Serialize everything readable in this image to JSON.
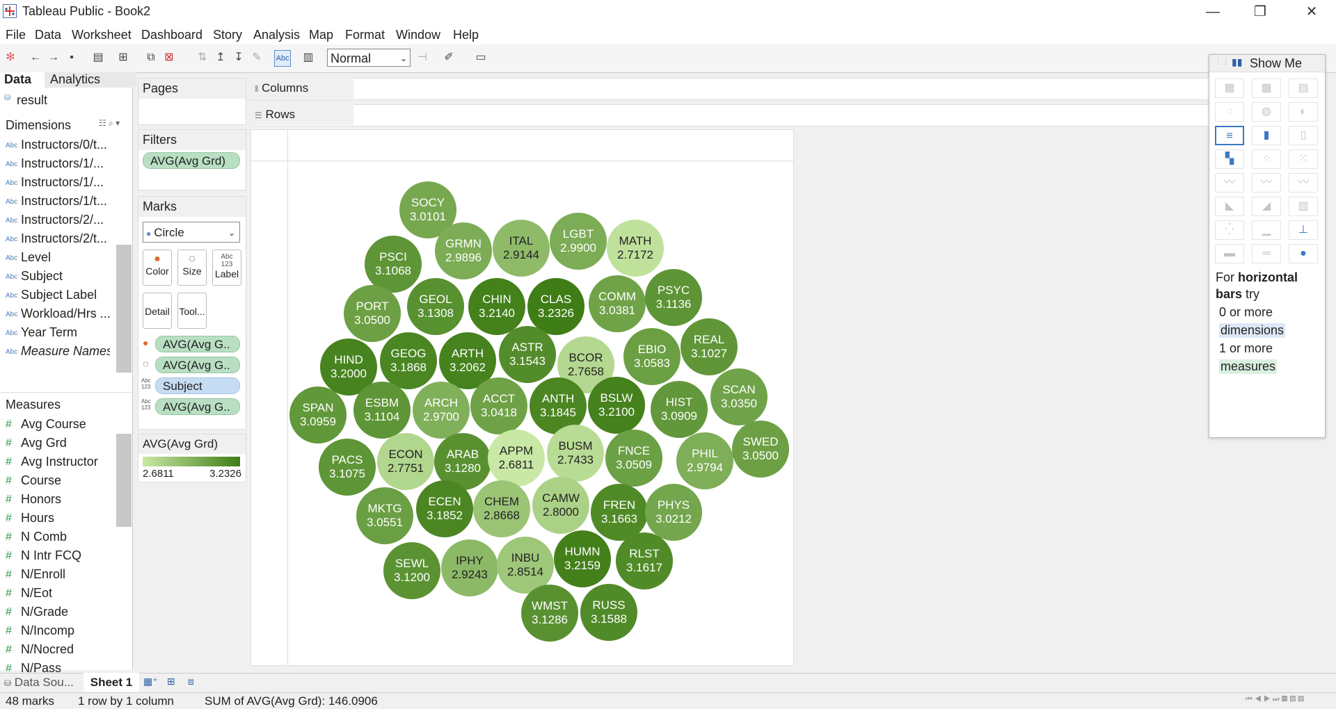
{
  "window": {
    "title": "Tableau Public - Book2",
    "min": "—",
    "restore": "❐",
    "close": "✕"
  },
  "menu": [
    "File",
    "Data",
    "Worksheet",
    "Dashboard",
    "Story",
    "Analysis",
    "Map",
    "Format",
    "Window",
    "Help"
  ],
  "toolbar": {
    "fit_value": "Normal"
  },
  "left": {
    "tabs": [
      "Data",
      "Analytics"
    ],
    "datasource": "result",
    "dimensions_header": "Dimensions",
    "dimensions": [
      "Instructors/0/t...",
      "Instructors/1/...",
      "Instructors/1/...",
      "Instructors/1/t...",
      "Instructors/2/...",
      "Instructors/2/t...",
      "Level",
      "Subject",
      "Subject Label",
      "Workload/Hrs ...",
      "Year Term",
      "Measure Names"
    ],
    "measures_header": "Measures",
    "measures": [
      "Avg Course",
      "Avg Grd",
      "Avg Instructor",
      "Course",
      "Honors",
      "Hours",
      "N Comb",
      "N Intr FCQ",
      "N/Enroll",
      "N/Eot",
      "N/Grade",
      "N/Incomp",
      "N/Nocred",
      "N/Pass"
    ]
  },
  "pages": {
    "title": "Pages"
  },
  "filters": {
    "title": "Filters",
    "pill": "AVG(Avg Grd)"
  },
  "marks": {
    "title": "Marks",
    "type": "Circle",
    "buttons": [
      "Color",
      "Size",
      "Label",
      "Detail",
      "Tool..."
    ],
    "pills": [
      "AVG(Avg G..",
      "AVG(Avg G..",
      "Subject",
      "AVG(Avg G.."
    ]
  },
  "legend": {
    "title": "AVG(Avg Grd)",
    "min": "2.6811",
    "max": "3.2326",
    "color_low": "#c9e8a5",
    "color_high": "#3f7d16"
  },
  "shelves": {
    "columns": "Columns",
    "rows": "Rows"
  },
  "chart_data": {
    "type": "packed-bubble",
    "measure": "AVG(Avg Grd)",
    "items": [
      {
        "subject": "SOCY",
        "value": 3.0101
      },
      {
        "subject": "PSCI",
        "value": 3.1068
      },
      {
        "subject": "GRMN",
        "value": 2.9896
      },
      {
        "subject": "ITAL",
        "value": 2.9144
      },
      {
        "subject": "LGBT",
        "value": 2.99
      },
      {
        "subject": "MATH",
        "value": 2.7172
      },
      {
        "subject": "PORT",
        "value": 3.05
      },
      {
        "subject": "GEOL",
        "value": 3.1308
      },
      {
        "subject": "CHIN",
        "value": 3.214
      },
      {
        "subject": "CLAS",
        "value": 3.2326
      },
      {
        "subject": "COMM",
        "value": 3.0381
      },
      {
        "subject": "PSYC",
        "value": 3.1136
      },
      {
        "subject": "HIND",
        "value": 3.2
      },
      {
        "subject": "GEOG",
        "value": 3.1868
      },
      {
        "subject": "ARTH",
        "value": 3.2062
      },
      {
        "subject": "ASTR",
        "value": 3.1543
      },
      {
        "subject": "BCOR",
        "value": 2.7658
      },
      {
        "subject": "EBIO",
        "value": 3.0583
      },
      {
        "subject": "REAL",
        "value": 3.1027
      },
      {
        "subject": "SPAN",
        "value": 3.0959
      },
      {
        "subject": "ESBM",
        "value": 3.1104
      },
      {
        "subject": "ARCH",
        "value": 2.97
      },
      {
        "subject": "ACCT",
        "value": 3.0418
      },
      {
        "subject": "ANTH",
        "value": 3.1845
      },
      {
        "subject": "BSLW",
        "value": 3.21
      },
      {
        "subject": "HIST",
        "value": 3.0909
      },
      {
        "subject": "SCAN",
        "value": 3.035
      },
      {
        "subject": "PACS",
        "value": 3.1075
      },
      {
        "subject": "ECON",
        "value": 2.7751
      },
      {
        "subject": "ARAB",
        "value": 3.128
      },
      {
        "subject": "APPM",
        "value": 2.6811
      },
      {
        "subject": "BUSM",
        "value": 2.7433
      },
      {
        "subject": "FNCE",
        "value": 3.0509
      },
      {
        "subject": "PHIL",
        "value": 2.9794
      },
      {
        "subject": "SWED",
        "value": 3.05
      },
      {
        "subject": "MKTG",
        "value": 3.0551
      },
      {
        "subject": "ECEN",
        "value": 3.1852
      },
      {
        "subject": "CHEM",
        "value": 2.8668
      },
      {
        "subject": "CAMW",
        "value": 2.8
      },
      {
        "subject": "FREN",
        "value": 3.1663
      },
      {
        "subject": "PHYS",
        "value": 3.0212
      },
      {
        "subject": "SEWL",
        "value": 3.12
      },
      {
        "subject": "IPHY",
        "value": 2.9243
      },
      {
        "subject": "INBU",
        "value": 2.8514
      },
      {
        "subject": "HUMN",
        "value": 3.2159
      },
      {
        "subject": "RLST",
        "value": 3.1617
      },
      {
        "subject": "WMST",
        "value": 3.1286
      },
      {
        "subject": "RUSS",
        "value": 3.1588
      }
    ]
  },
  "showme": {
    "title": "Show Me",
    "hint_prefix": "For",
    "hint_bold": "horizontal bars",
    "hint_suffix": "try",
    "req1_count": "0 or more",
    "req1_label": "dimensions",
    "req2_count": "1 or more",
    "req2_label": "measures"
  },
  "sheets": {
    "datasource_tab": "Data Sou...",
    "sheet1": "Sheet 1"
  },
  "status": {
    "marks": "48 marks",
    "layout": "1 row by 1 column",
    "sum": "SUM of AVG(Avg Grd): 146.0906"
  }
}
